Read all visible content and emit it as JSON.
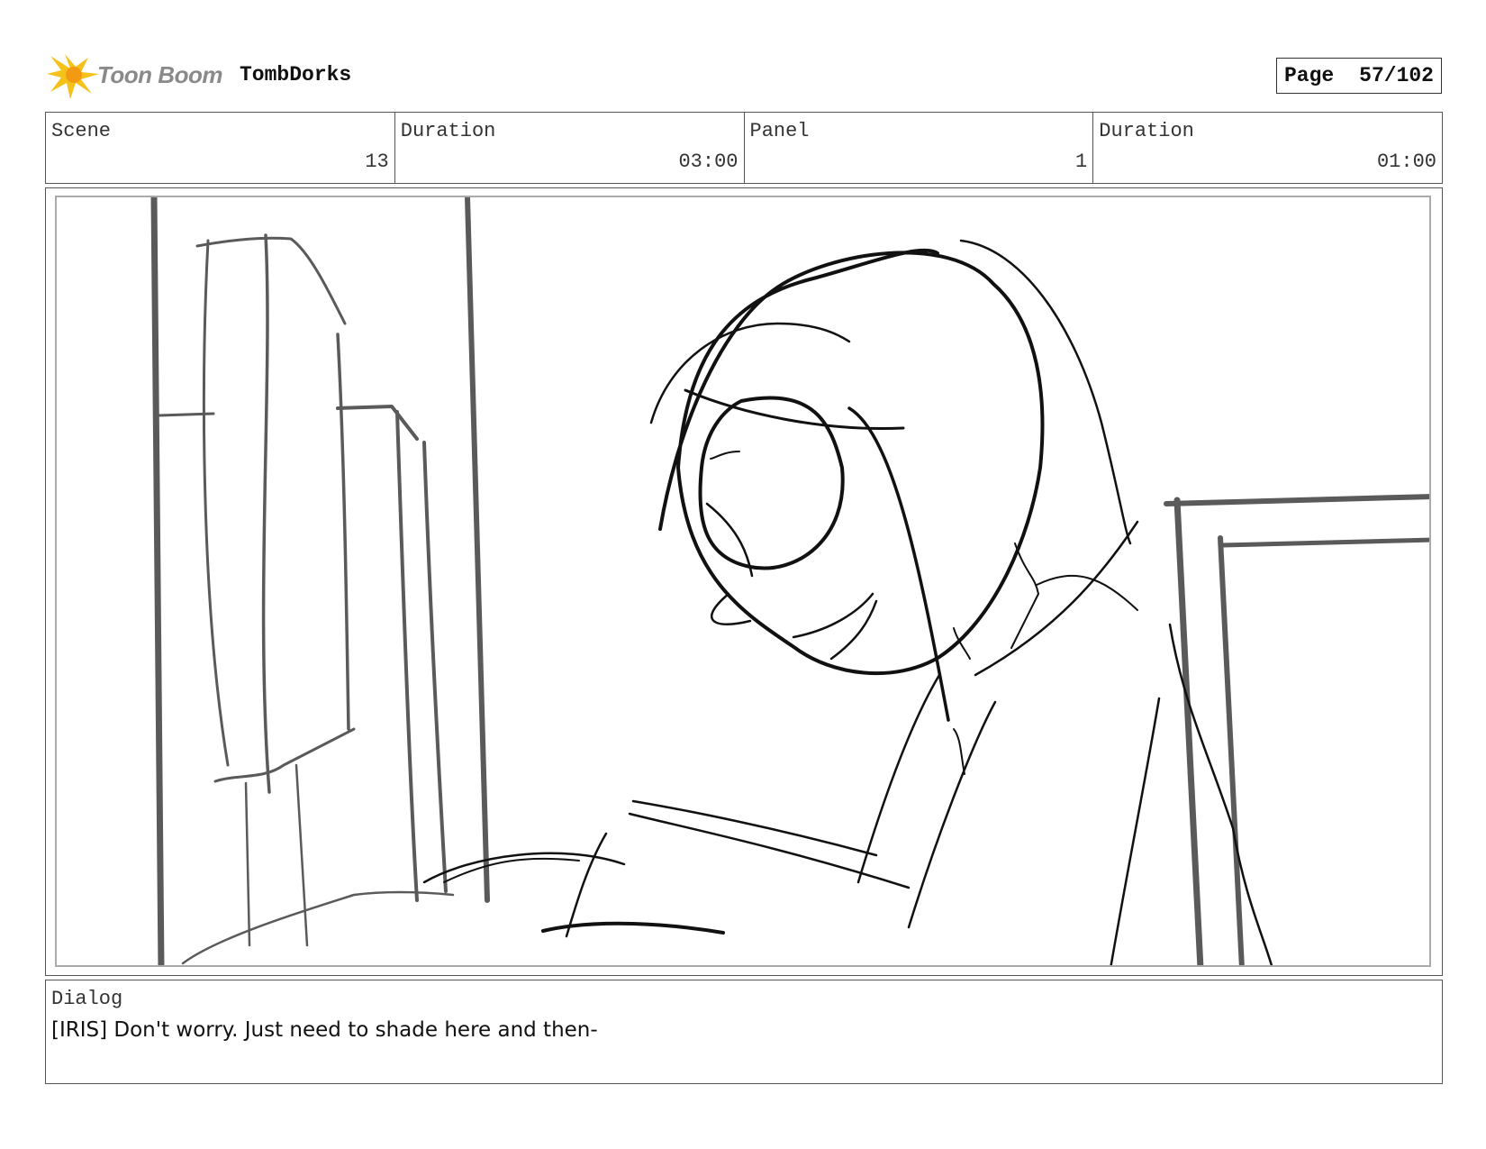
{
  "header": {
    "brand_name": "Toon Boom",
    "project_title": "TombDorks",
    "page_label": "Page",
    "page_value": "57/102"
  },
  "info": {
    "scene_label": "Scene",
    "scene_value": "13",
    "scene_duration_label": "Duration",
    "scene_duration_value": "03:00",
    "panel_label": "Panel",
    "panel_value": "1",
    "panel_duration_label": "Duration",
    "panel_duration_value": "01:00"
  },
  "dialog": {
    "label": "Dialog",
    "text": "[IRIS] Don't worry. Just need to shade here and then-"
  },
  "colors": {
    "logo_yellow": "#f5c21b",
    "logo_orange": "#f39a12",
    "sketch_dark": "#111111",
    "sketch_grey": "#5a5a5a"
  }
}
